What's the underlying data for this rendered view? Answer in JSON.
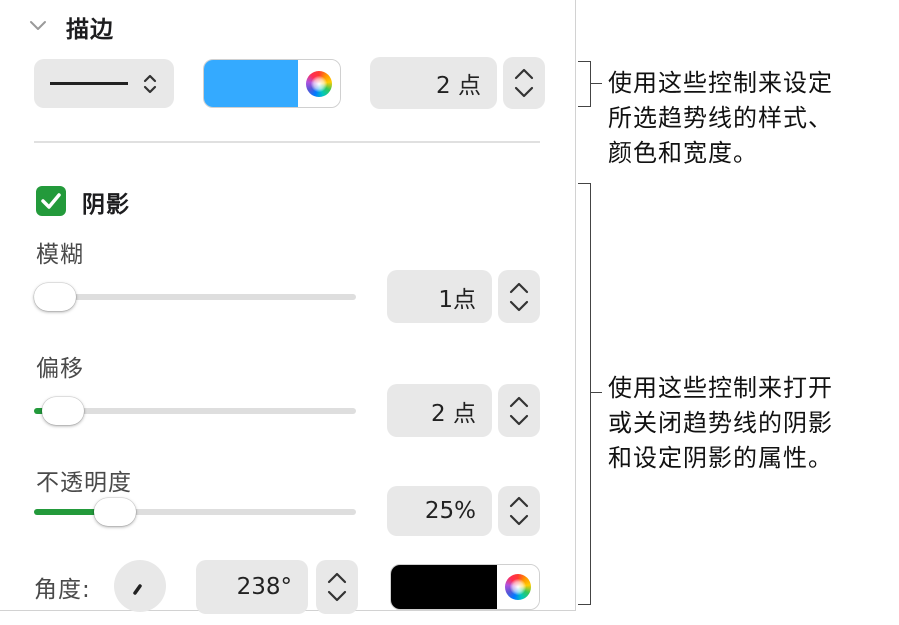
{
  "stroke": {
    "title": "描边",
    "width_value": "2 点",
    "color": "#34aaff"
  },
  "shadow": {
    "checkbox_label": "阴影",
    "checked": true,
    "blur": {
      "label": "模糊",
      "value": "1点",
      "slider_fraction": 0.05
    },
    "offset": {
      "label": "偏移",
      "value": "2 点",
      "slider_fraction": 0.09
    },
    "opacity": {
      "label": "不透明度",
      "value": "25%",
      "slider_fraction": 0.25
    },
    "angle": {
      "label": "角度:",
      "value": "238°"
    },
    "color": "#000000"
  },
  "annotations": {
    "stroke_note": [
      "使用这些控制来设定",
      "所选趋势线的样式、",
      "颜色和宽度。"
    ],
    "shadow_note": [
      "使用这些控制来打开",
      "或关闭趋势线的阴影",
      "和设定阴影的属性。"
    ]
  },
  "colors": {
    "accent_green": "#239a3b",
    "stroke_blue": "#34aaff"
  }
}
